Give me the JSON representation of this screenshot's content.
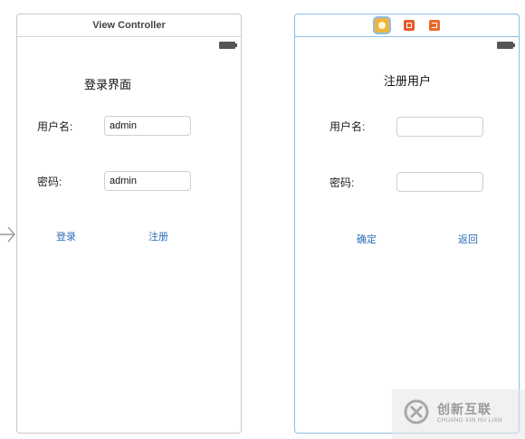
{
  "left_scene": {
    "header_title": "View Controller",
    "title": "登录界面",
    "username_label": "用户名:",
    "username_value": "admin",
    "password_label": "密码:",
    "password_value": "admin",
    "login_button": "登录",
    "register_button": "注册"
  },
  "right_scene": {
    "header_icons": [
      "view-controller-icon",
      "first-responder-icon",
      "exit-icon"
    ],
    "title": "注册用户",
    "username_label": "用户名:",
    "username_value": "",
    "password_label": "密码:",
    "password_value": "",
    "confirm_button": "确定",
    "back_button": "返回"
  },
  "watermark": {
    "text_cn": "创新互联",
    "text_en": "CHUANG XIN HU LIAN"
  },
  "colors": {
    "link": "#2a6db5",
    "selected_border": "#8fbde3",
    "icon_orange": "#e8692b",
    "icon_yellow": "#f0b43a"
  }
}
